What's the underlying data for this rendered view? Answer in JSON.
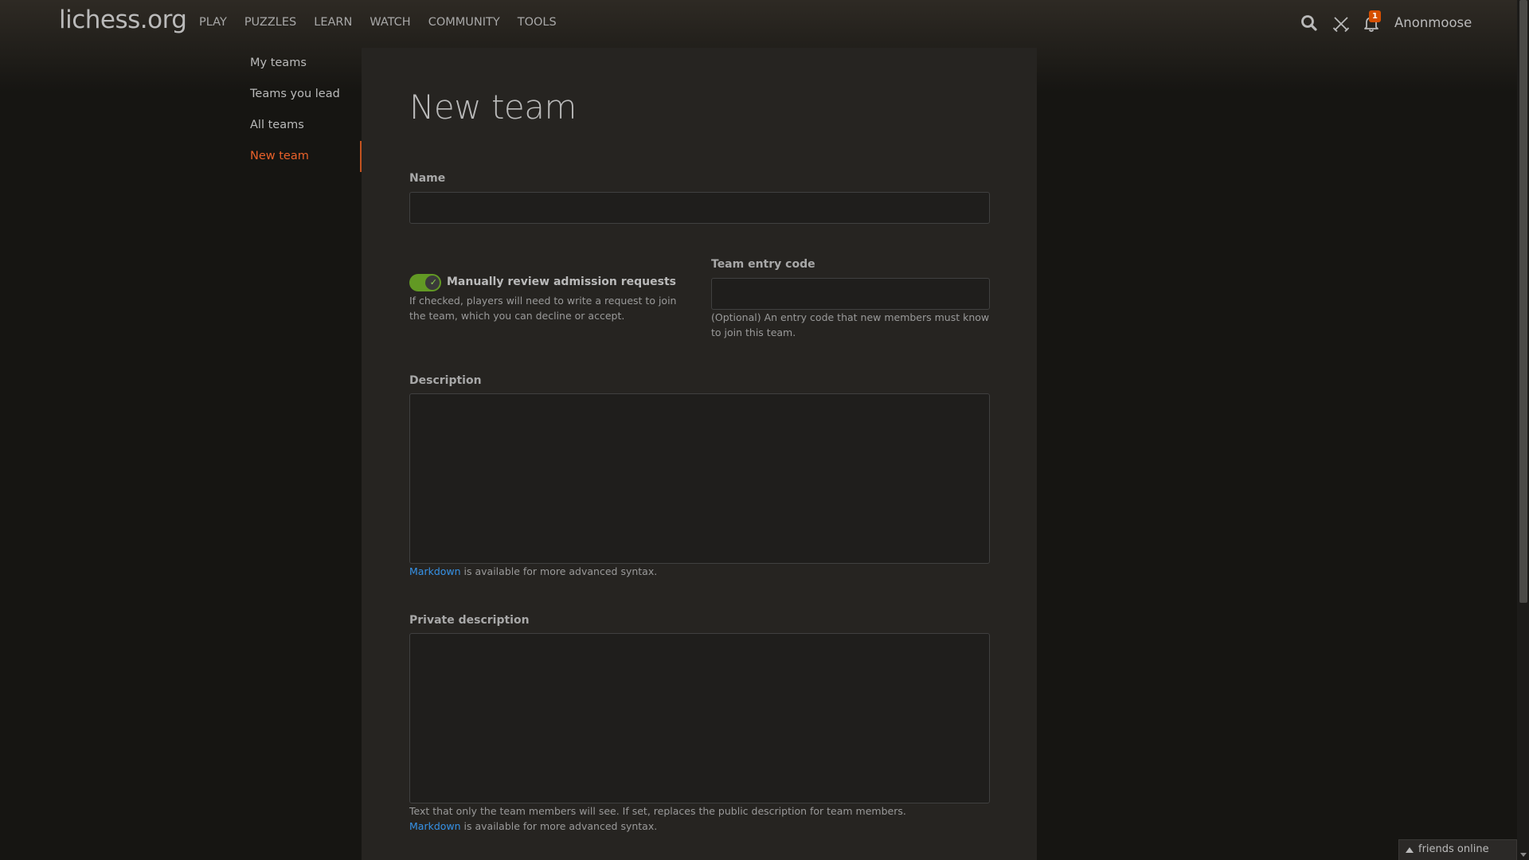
{
  "header": {
    "logo": "lichess.org",
    "nav": [
      "PLAY",
      "PUZZLES",
      "LEARN",
      "WATCH",
      "COMMUNITY",
      "TOOLS"
    ],
    "notification_count": "1",
    "username": "Anonmoose"
  },
  "sidebar": {
    "items": [
      {
        "label": "My teams"
      },
      {
        "label": "Teams you lead"
      },
      {
        "label": "All teams"
      },
      {
        "label": "New team",
        "active": true
      }
    ]
  },
  "form": {
    "title": "New team",
    "name_label": "Name",
    "name_value": "",
    "review_label": "Manually review admission requests",
    "review_checked": true,
    "review_help": "If checked, players will need to write a request to join the team, which you can decline or accept.",
    "entry_code_label": "Team entry code",
    "entry_code_value": "",
    "entry_code_help": "(Optional) An entry code that new members must know to join this team.",
    "description_label": "Description",
    "description_value": "",
    "markdown_link": "Markdown",
    "markdown_text": " is available for more advanced syntax.",
    "private_label": "Private description",
    "private_value": "",
    "private_help": "Text that only the team members will see. If set, replaces the public description for team members."
  },
  "footer": {
    "friends_online": "friends online"
  },
  "colors": {
    "accent": "#e9612a",
    "toggle_on": "#629924",
    "link": "#3692e7",
    "background": "#161512",
    "panel": "#262421"
  }
}
